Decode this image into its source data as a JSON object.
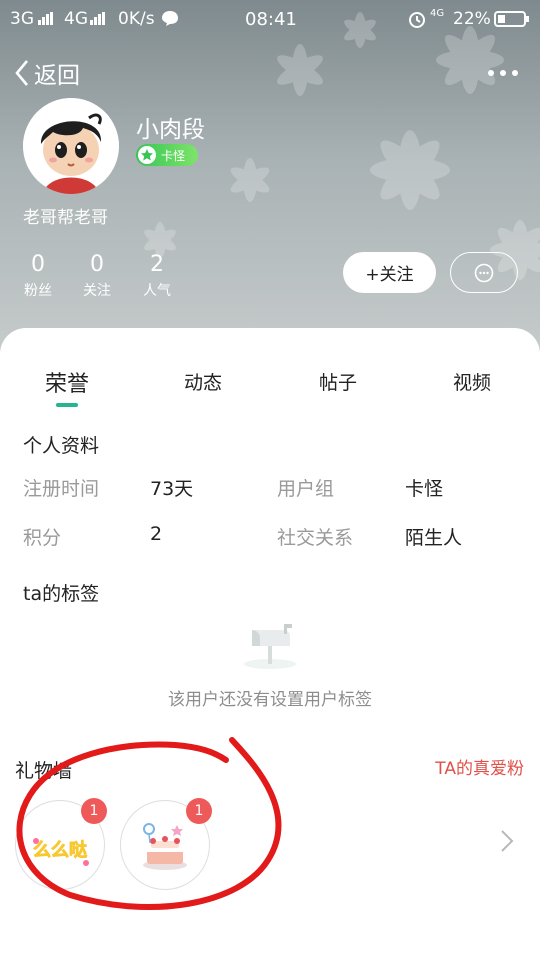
{
  "status_bar": {
    "network1": "3G",
    "network2": "4G",
    "speed": "0K/s",
    "time": "08:41",
    "signal_tag": "4G",
    "battery": "22%"
  },
  "nav": {
    "back_label": "返回"
  },
  "profile": {
    "nickname": "小肉段",
    "level_badge": "卡怪",
    "bio": "老哥帮老哥",
    "stats": [
      {
        "value": "0",
        "label": "粉丝"
      },
      {
        "value": "0",
        "label": "关注"
      },
      {
        "value": "2",
        "label": "人气"
      }
    ],
    "follow_label": "+关注"
  },
  "tabs": [
    {
      "label": "荣誉",
      "active": true
    },
    {
      "label": "动态",
      "active": false
    },
    {
      "label": "帖子",
      "active": false
    },
    {
      "label": "视频",
      "active": false
    }
  ],
  "personal_info": {
    "title": "个人资料",
    "rows": [
      {
        "k1": "注册时间",
        "v1": "73天",
        "k2": "用户组",
        "v2": "卡怪"
      },
      {
        "k1": "积分",
        "v1": "2",
        "k2": "社交关系",
        "v2": "陌生人"
      }
    ]
  },
  "tags": {
    "title": "ta的标签",
    "empty_text": "该用户还没有设置用户标签"
  },
  "gift_wall": {
    "title": "礼物墙",
    "fans_link": "TA的真爱粉",
    "gifts": [
      {
        "name": "么么哒",
        "count": "1"
      },
      {
        "name": "cake",
        "count": "1"
      }
    ]
  },
  "colors": {
    "accent": "#26b58f",
    "link_red": "#e0514a",
    "badge_green": "#37c655",
    "count_red": "#ee5a5a",
    "annotation_red": "#e21a1a"
  }
}
